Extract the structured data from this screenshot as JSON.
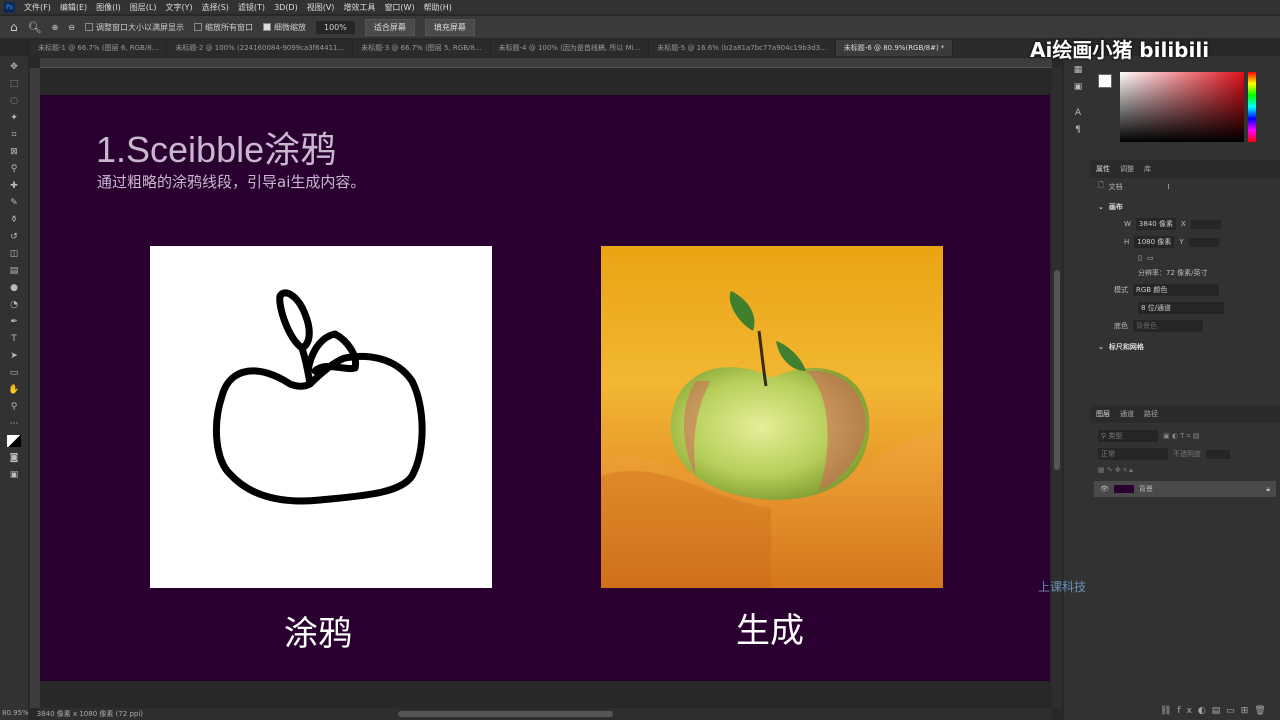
{
  "menu": [
    "文件(F)",
    "编辑(E)",
    "图像(I)",
    "图层(L)",
    "文字(Y)",
    "选择(S)",
    "滤镜(T)",
    "3D(D)",
    "视图(V)",
    "增效工具",
    "窗口(W)",
    "帮助(H)"
  ],
  "options": {
    "resize_windows": "调整窗口大小以满屏显示",
    "zoom_all": "缩放所有窗口",
    "scrubby_zoom": "细微缩放",
    "zoom_value": "100%",
    "fit_screen": "适合屏幕",
    "fill_screen": "填充屏幕"
  },
  "tabs": [
    {
      "label": "未标题-1 @ 66.7% (图层 6, RGB/8...",
      "active": false
    },
    {
      "label": "未标题-2 @ 100% (224160084-9099ca3f64411...",
      "active": false
    },
    {
      "label": "未标题-3 @ 66.7% (图层 5, RGB/8...",
      "active": false
    },
    {
      "label": "未标题-4 @ 100% (因为是首线稿, 所以 Mi...",
      "active": false
    },
    {
      "label": "未标题-5 @ 16.6% (b2a81a7bc77a904c19b3d3...",
      "active": false
    },
    {
      "label": "未标题-6 @ 80.9%(RGB/8#) *",
      "active": true
    }
  ],
  "canvas": {
    "title": "1.Sceibble涂鸦",
    "subtitle": "通过粗略的涂鸦线段，引导ai生成内容。",
    "left_label": "涂鸦",
    "right_label": "生成",
    "bg": "#29002f"
  },
  "properties": {
    "tabs": [
      "属性",
      "调整",
      "库"
    ],
    "doc": "文档",
    "canvas_section": "画布",
    "w": "3840 像素",
    "h": "1080 像素",
    "x_label": "X",
    "y_label": "Y",
    "w_label": "W",
    "h_label": "H",
    "resolution": "分辨率：72 像素/英寸",
    "mode_label": "模式",
    "mode": "RGB 颜色",
    "depth": "8 位/通道",
    "bg_label": "底色",
    "bg_value": "背景色",
    "rulers_section": "标尺和网格"
  },
  "layers": {
    "tabs": [
      "图层",
      "通道",
      "路径"
    ],
    "search": "类型",
    "blend": "正常",
    "opacity_label": "不透明度",
    "layer_name": "背景"
  },
  "status": {
    "zoom": "80.95%",
    "doc_size": "3840 像素 x 1080 像素 (72 ppi)"
  },
  "watermark": {
    "channel": "Ai绘画小猪 bilibili",
    "logo": "上课科技"
  }
}
